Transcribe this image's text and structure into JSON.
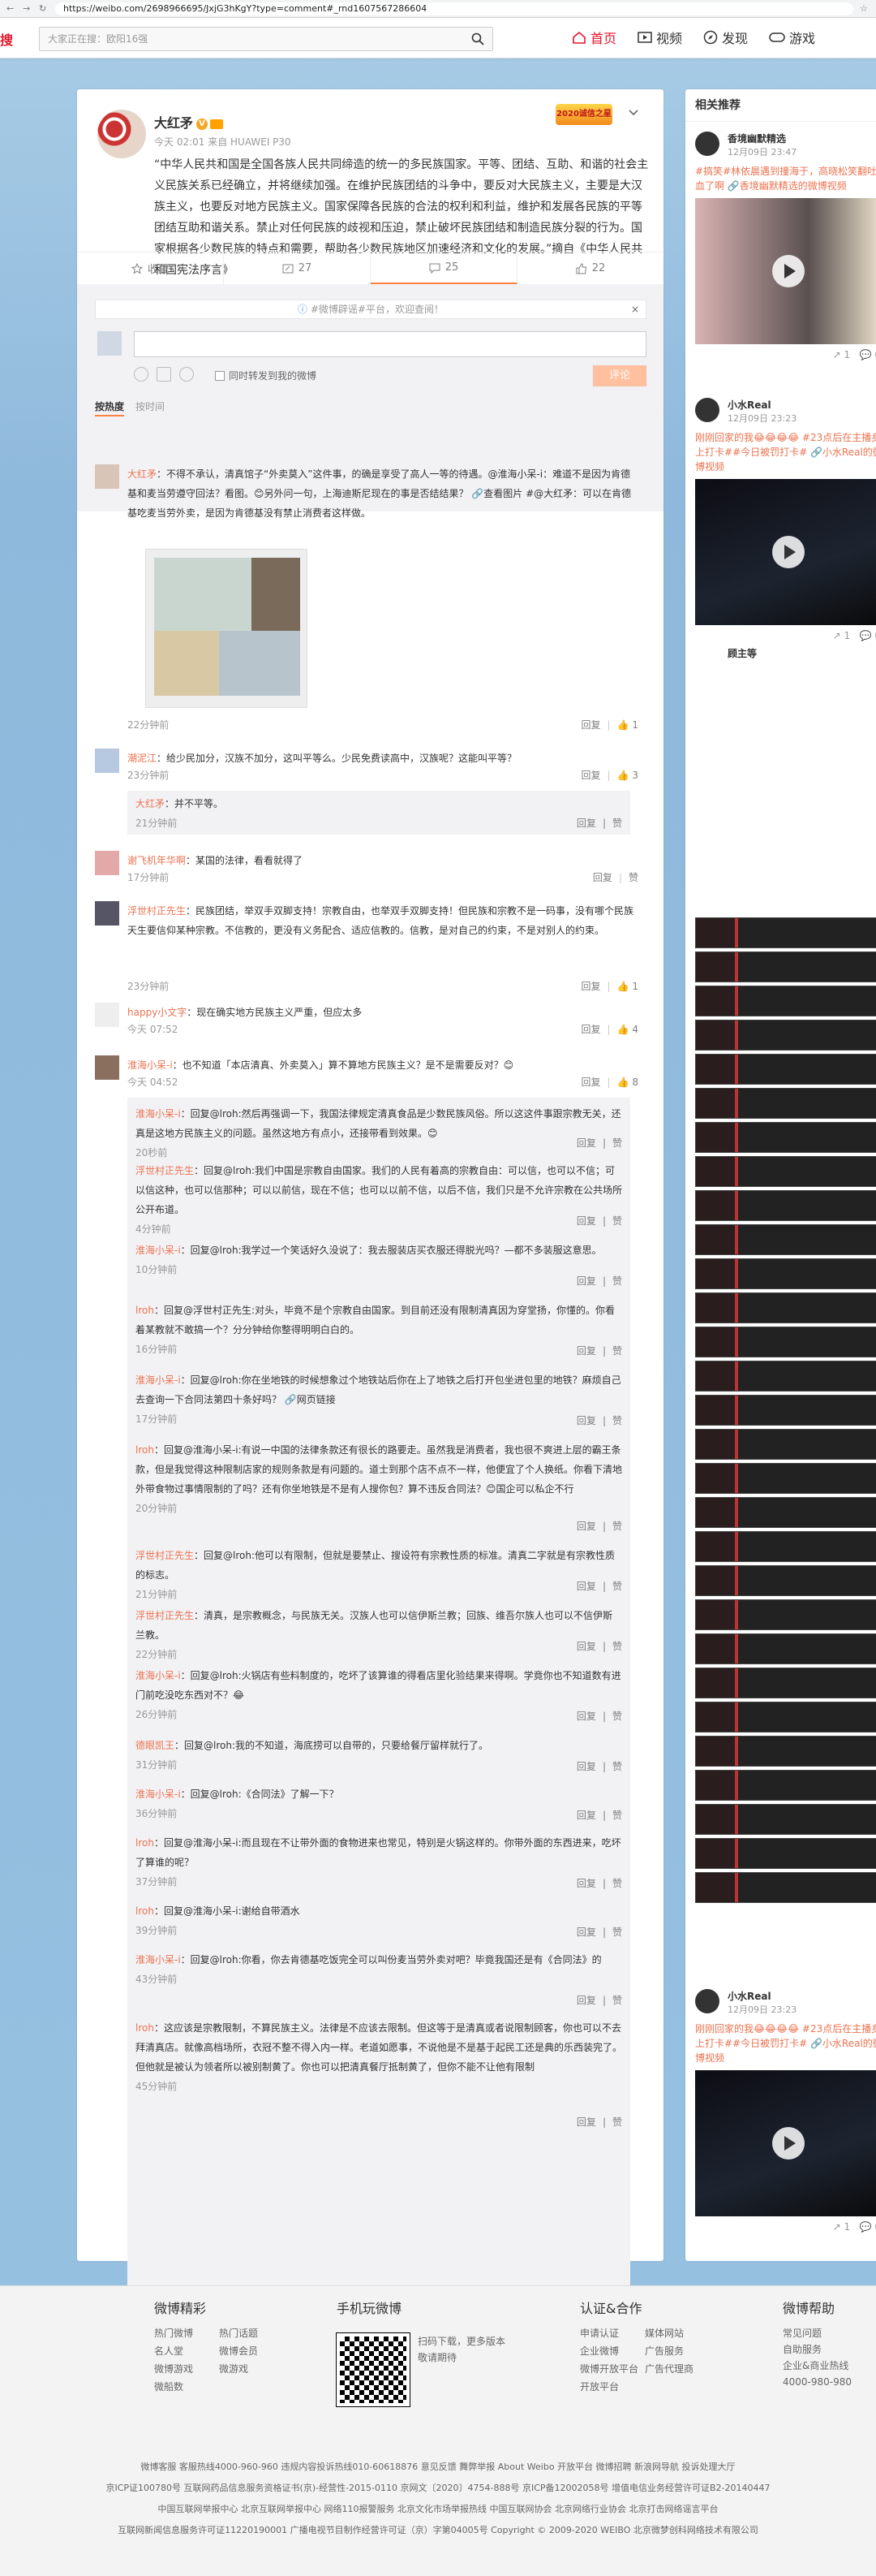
{
  "browser": {
    "url": "https://weibo.com/2698966695/JxjG3hKgY?type=comment#_rnd1607567286604"
  },
  "header": {
    "logo": "搜",
    "search_placeholder": "大家正在搜：欧阳16强",
    "nav": [
      "首页",
      "视频",
      "发现",
      "游戏"
    ]
  },
  "post": {
    "author": "大红矛",
    "meta": "今天 02:01 来自 HUAWEI P30",
    "medal_text": "2020诚信之星",
    "text": "“中华人民共和国是全国各族人民共同缔造的统一的多民族国家。平等、团结、互助、和谐的社会主义民族关系已经确立，并将继续加强。在维护民族团结的斗争中，要反对大民族主义，主要是大汉族主义，也要反对地方民族主义。国家保障各民族的合法的权利和利益，维护和发展各民族的平等团结互助和谐关系。禁止对任何民族的歧视和压迫，禁止破坏民族团结和制造民族分裂的行为。国家根据各少数民族的特点和需要，帮助各少数民族地区加速经济和文化的发展。”摘自《中华人民共和国宪法序言》",
    "actions": [
      {
        "icon": "star-icon",
        "label": "收藏"
      },
      {
        "icon": "share-icon",
        "label": "27"
      },
      {
        "icon": "comment-icon",
        "label": "25"
      },
      {
        "icon": "like-icon",
        "label": "22"
      }
    ]
  },
  "comment_box": {
    "tip": "#微博辟谣#平台，欢迎查阅！",
    "tip_link": "欢迎查阅！",
    "forward_label": "同时转发到我的微博",
    "submit": "评论",
    "sort_hot": "按热度",
    "sort_time": "按时间"
  },
  "comments": [
    {
      "name": "大红矛",
      "text": "：不得不承认，清真馆子“外卖莫入”这件事，的确是享受了高人一等的待遇。@淮海小呆-i：难道不是因为肯德基和麦当劳遵守回法？看图。😊另外问一句，上海迪斯尼现在的事是否结结果？ 🔗查看图片 #@大红矛：可以在肯德基吃麦当劳外卖，是因为肯德基没有禁止消费者这样做。",
      "time": "22分钟前",
      "reply": "回复",
      "likes": "1"
    },
    {
      "name": "潮泥江",
      "text": "：给少民加分，汉族不加分，这叫平等么。少民免费读高中，汉族呢？这能叫平等？",
      "time": "23分钟前",
      "reply": "回复",
      "likes": "3",
      "sub": [
        {
          "name": "大红矛",
          "text": "：并不平等。",
          "time": "21分钟前",
          "reply": "回复",
          "like": "赞"
        }
      ]
    },
    {
      "name": "谢飞机年华啊",
      "text": "：某国的法律，看看就得了",
      "time": "17分钟前",
      "reply": "回复",
      "likes": "赞"
    },
    {
      "name": "浮世村正先生",
      "text": "：民族团结，举双手双脚支持！宗教自由，也举双手双脚支持！但民族和宗教不是一码事，没有哪个民族天生要信仰某种宗教。不信教的，更没有义务配合、适应信教的。信教，是对自己的约束，不是对别人的约束。",
      "time": "23分钟前",
      "reply": "回复",
      "likes": "1"
    },
    {
      "name": "happy小文字",
      "text": "：现在确实地方民族主义严重，但应太多",
      "time": "今天 07:52",
      "reply": "回复",
      "likes": "4"
    },
    {
      "name": "淮海小呆-i",
      "text": "：也不知道「本店清真、外卖莫入」算不算地方民族主义？是不是需要反对？😊",
      "time": "今天 04:52",
      "reply": "回复",
      "likes": "8",
      "sub": [
        {
          "name": "淮海小呆-i",
          "text": "：回复@lroh:然后再强调一下，我国法律规定清真食品是少数民族风俗。所以这这件事跟宗教无关，还真是这地方民族主义的问题。虽然这地方有点小，还接带看到效果。😊",
          "time": "20秒前",
          "reply": "回复",
          "like": "赞"
        },
        {
          "name": "浮世村正先生",
          "text": "：回复@lroh:我们中国是宗教自由国家。我们的人民有着高的宗教自由：可以信，也可以不信；可以信这种，也可以信那种；可以以前信，现在不信；也可以以前不信，以后不信，我们只是不允许宗教在公共场所公开布道。",
          "time": "4分钟前",
          "reply": "回复",
          "like": "赞"
        },
        {
          "name": "淮海小呆-i",
          "text": "：回复@lroh:我学过一个笑话好久没说了：我去服装店买衣服还得脱光吗？—都不多装服这意思。",
          "time": "10分钟前",
          "reply": "回复",
          "like": "赞"
        },
        {
          "name": "lroh",
          "text": "：回复@浮世村正先生:对头，毕竟不是个宗教自由国家。到目前还没有限制清真因为穿堂扬，你懂的。你看着某教就不敢搞一个？分分钟给你整得明明白白的。",
          "time": "16分钟前",
          "reply": "回复",
          "like": "赞"
        },
        {
          "name": "淮海小呆-i",
          "text": "：回复@lroh:你在坐地铁的时候想象过个地铁站后你在上了地铁之后打开包坐进包里的地铁？麻烦自己去查询一下合同法第四十条好吗？ 🔗网页链接",
          "time": "17分钟前",
          "reply": "回复",
          "like": "赞"
        },
        {
          "name": "lroh",
          "text": "：回复@淮海小呆-i:有说一中国的法律条款还有很长的路要走。虽然我是消费者，我也很不爽进上层的霸王条款，但是我觉得这种限制店家的规则条款是有问题的。道士到那个店不点不一样，他便宜了个人换纸。你看下清地外带食物过事情限制的了吗？还有你坐地铁是不是有人搜你包？算不违反合同法？😊国企可以私企不行",
          "time": "20分钟前",
          "reply": "回复",
          "like": "赞"
        },
        {
          "name": "浮世村正先生",
          "text": "：回复@lroh:他可以有限制，但就是要禁止、搜设符有宗教性质的标准。清真二字就是有宗教性质的标志。",
          "time": "21分钟前",
          "reply": "回复",
          "like": "赞"
        },
        {
          "name": "浮世村正先生",
          "text": "：清真，是宗教概念，与民族无关。汉族人也可以信伊斯兰教；回族、维吾尔族人也可以不信伊斯兰教。",
          "time": "22分钟前",
          "reply": "回复",
          "like": "赞"
        },
        {
          "name": "淮海小呆-i",
          "text": "：回复@lroh:火锅店有些料制度的，吃坏了该算谁的得看店里化验结果来得啊。学竟你也不知道数有进门前吃没吃东西对不？😂",
          "time": "26分钟前",
          "reply": "回复",
          "like": "赞"
        },
        {
          "name": "德眼凯王",
          "text": "：回复@lroh:我的不知道，海底捞可以自带的，只要给餐厅留样就行了。",
          "time": "31分钟前",
          "reply": "回复",
          "like": "赞"
        },
        {
          "name": "淮海小呆-i",
          "text": "：回复@lroh:《合同法》了解一下？",
          "time": "36分钟前",
          "reply": "回复",
          "like": "赞"
        },
        {
          "name": "lroh",
          "text": "：回复@淮海小呆-i:而且现在不让带外面的食物进来也常见，特别是火锅这样的。你带外面的东西进来，吃坏了算谁的呢？",
          "time": "37分钟前",
          "reply": "回复",
          "like": "赞"
        },
        {
          "name": "lroh",
          "text": "：回复@淮海小呆-i:谢给自带酒水",
          "time": "39分钟前",
          "reply": "回复",
          "like": "赞"
        },
        {
          "name": "淮海小呆-i",
          "text": "：回复@lroh:你看，你去肯德基吃饭完全可以叫份麦当劳外卖对吧？毕竟我国还是有《合同法》的",
          "time": "43分钟前",
          "reply": "回复",
          "like": "赞"
        },
        {
          "name": "lroh",
          "text": "：这应该是宗教限制，不算民族主义。法律是不应该去限制。但这等于是清真或者说限制顾客，你也可以不去拜清真店。就像高档场所，衣冠不整不得入内一样。老道如愿事，不说他是不是基于起民工还是典的乐西装完了。但他就是被认为领者所以被别制黄了。你也可以把清真餐厅抵制黄了，但你不能不让他有限制",
          "time": "45分钟前",
          "reply": "回复",
          "like": "赞"
        }
      ]
    }
  ],
  "sidebar": {
    "title": "相关推荐",
    "videos": [
      {
        "author": "香境幽默精选",
        "time": "12月09日 23:47",
        "desc": "#搞笑#林依晨遇到撞海于，高晓松笑翻吐血了啊 🔗香境幽默精选的微博视频",
        "reposts": "1",
        "comments": "0"
      },
      {
        "author": "小水Real",
        "time": "12月09日 23:23",
        "desc": "刚刚回家的我😂😂😂😂 #23点后在主播身上打卡##今日被罚打卡# 🔗小水Real的微博视频",
        "reposts": "1",
        "comments": "0"
      },
      {
        "author": "小水Real",
        "time": "12月09日 23:23",
        "desc": "刚刚回家的我😂😂😂😂 #23点后在主播身上打卡##今日被罚打卡# 🔗小水Real的微博视频",
        "reposts": "1",
        "comments": "0"
      }
    ],
    "more": "顾主等"
  },
  "footer": {
    "cols": [
      {
        "title": "微博精彩",
        "items": [
          "热门微博",
          "热门话题",
          "名人堂",
          "微博会员",
          "微博游戏",
          "微游戏",
          "微船数"
        ]
      },
      {
        "title": "手机玩微博",
        "items": [
          "扫码下载，更多版本",
          "敬请期待"
        ]
      },
      {
        "title": "认证&合作",
        "items": [
          "申请认证",
          "媒体网站",
          "企业微博",
          "广告服务",
          "微博开放平台",
          "广告代理商",
          "开放平台"
        ]
      },
      {
        "title": "微博帮助",
        "items": [
          "常见问题",
          "自助服务",
          "企业&商业热线",
          "4000-980-980"
        ]
      }
    ],
    "links": [
      "微博客服 客服热线4000-960-960 违规内容投诉热线010-60618876 意见反馈 舞弊举报 About Weibo 开放平台 微博招聘 新浪网导航 投诉处理大厅",
      "京ICP证100780号 互联网药品信息服务资格证书(京)-经营性-2015-0110 京网文〔2020〕4754-888号 京ICP备12002058号 增值电信业务经营许可证B2-20140447",
      "中国互联网举报中心 北京互联网举报中心 网络110报警服务 北京文化市场举报热线 中国互联网协会 北京网络行业协会 北京打击网络谣言平台",
      "互联网新闻信息服务许可证11220190001 广播电视节目制作经营许可证（京）字第04005号 Copyright © 2009-2020 WEIBO 北京微梦创科网络技术有限公司"
    ]
  },
  "colors": {
    "accent": "#eb7350",
    "brand": "#e6162d",
    "bg": "#9ec4e1"
  }
}
